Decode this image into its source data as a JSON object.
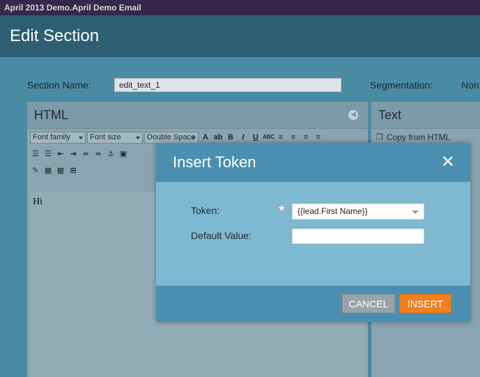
{
  "window": {
    "title": "April 2013 Demo.April Demo Email"
  },
  "header": {
    "title": "Edit Section"
  },
  "form": {
    "section_name_label": "Section Name:",
    "section_name_value": "edit_text_1",
    "segmentation_label": "Segmentation:",
    "segmentation_value": "Non"
  },
  "html_panel": {
    "title": "HTML",
    "toolbar": {
      "font_family": "Font family",
      "font_size": "Font size",
      "spacing": "Double Space"
    },
    "content": "Hi"
  },
  "text_panel": {
    "title": "Text",
    "copy_button": "Copy from HTML"
  },
  "modal": {
    "title": "Insert Token",
    "token_label": "Token:",
    "token_value": "{{lead.First Name}}",
    "default_value_label": "Default Value:",
    "default_value": "",
    "cancel_label": "CANCEL",
    "insert_label": "INSERT"
  },
  "colors": {
    "modal_header": "#4b8fb0",
    "modal_body": "#7fb8d1",
    "insert_button": "#f07f1e",
    "cancel_button": "#9aa3a8"
  }
}
